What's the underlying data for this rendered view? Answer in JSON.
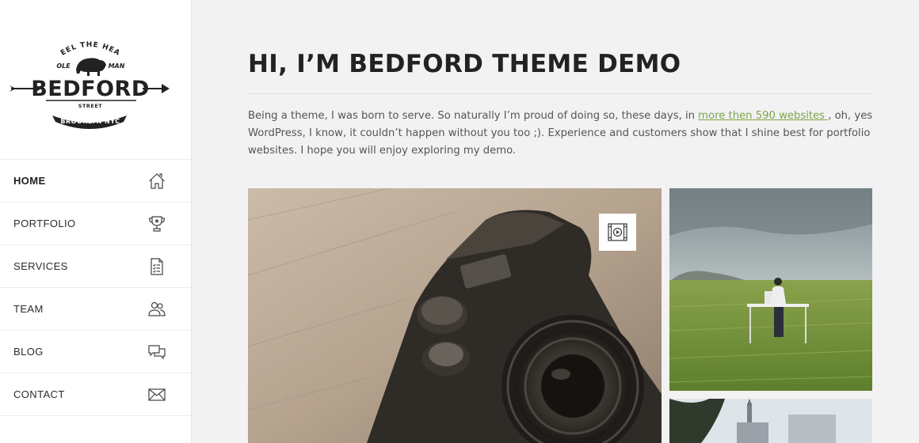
{
  "logo": {
    "tagline": "FEEL THE HEAT",
    "left_word": "OLE",
    "right_word": "MAN",
    "name": "BEDFORD",
    "street": "STREET",
    "city": "BROOKLYN NYC"
  },
  "nav": {
    "items": [
      {
        "label": "HOME",
        "icon": "home-icon",
        "active": true
      },
      {
        "label": "PORTFOLIO",
        "icon": "trophy-icon"
      },
      {
        "label": "SERVICES",
        "icon": "checklist-icon"
      },
      {
        "label": "TEAM",
        "icon": "users-icon"
      },
      {
        "label": "BLOG",
        "icon": "chat-icon"
      },
      {
        "label": "CONTACT",
        "icon": "envelope-icon"
      }
    ]
  },
  "main": {
    "title": "HI, I’M BEDFORD THEME DEMO",
    "intro_before_link": "Being a theme, I was born to serve. So naturally I’m proud of doing so, these days, in ",
    "intro_link": "more then 590 websites ",
    "intro_after_link": ", oh, yes WordPress, I know, it couldn’t happen without you too ;). Experience and customers show that I shine best for portfolio websites. I hope you will enjoy exploring my demo.",
    "link_color": "#7fa44a"
  },
  "gallery": {
    "badge_icon": "video-play-icon"
  }
}
